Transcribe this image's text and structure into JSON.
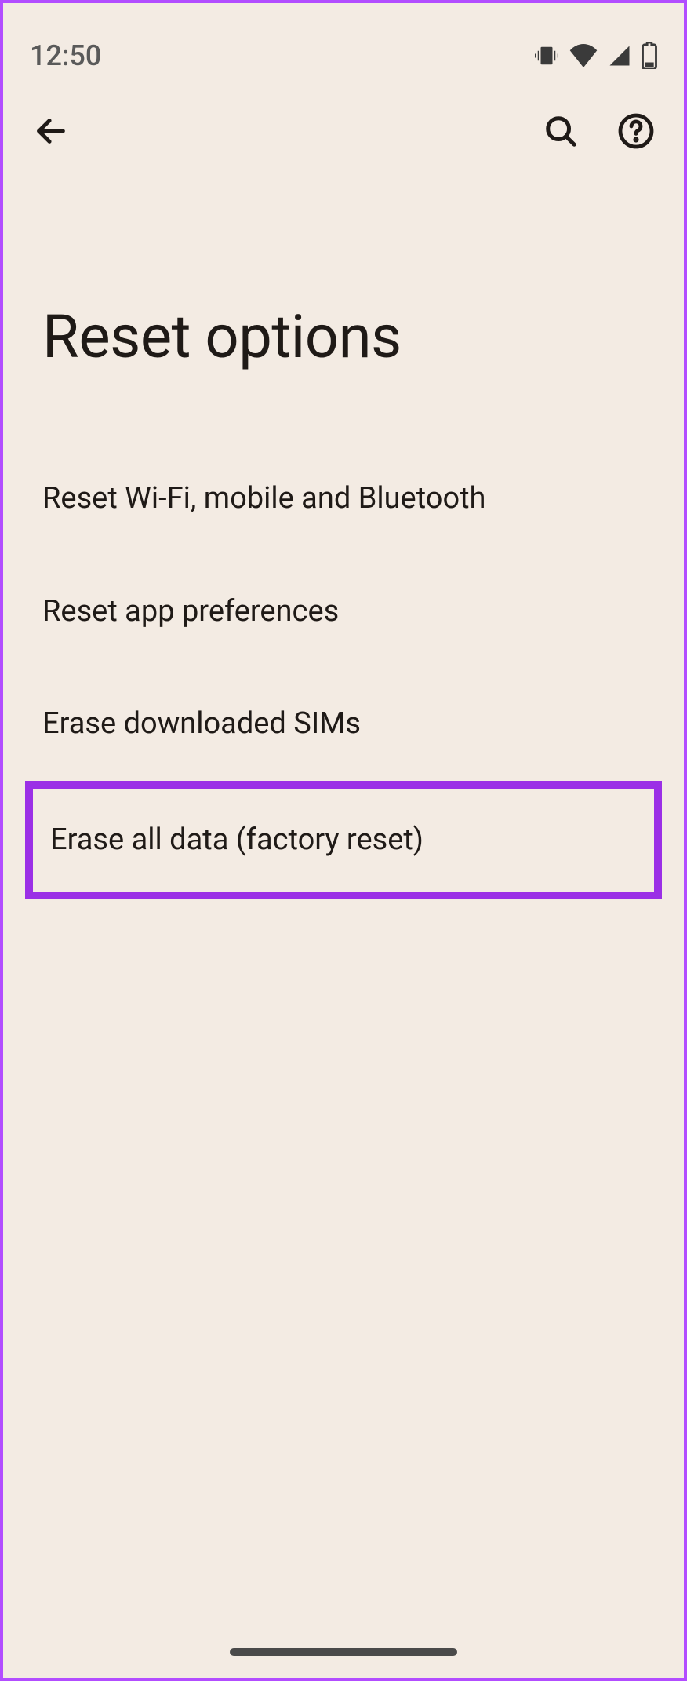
{
  "status": {
    "time": "12:50"
  },
  "page": {
    "title": "Reset options"
  },
  "options": [
    {
      "label": "Reset Wi-Fi, mobile and Bluetooth"
    },
    {
      "label": "Reset app preferences"
    },
    {
      "label": "Erase downloaded SIMs"
    },
    {
      "label": "Erase all data (factory reset)",
      "highlighted": true
    }
  ],
  "highlight_color": "#9b2fe6"
}
